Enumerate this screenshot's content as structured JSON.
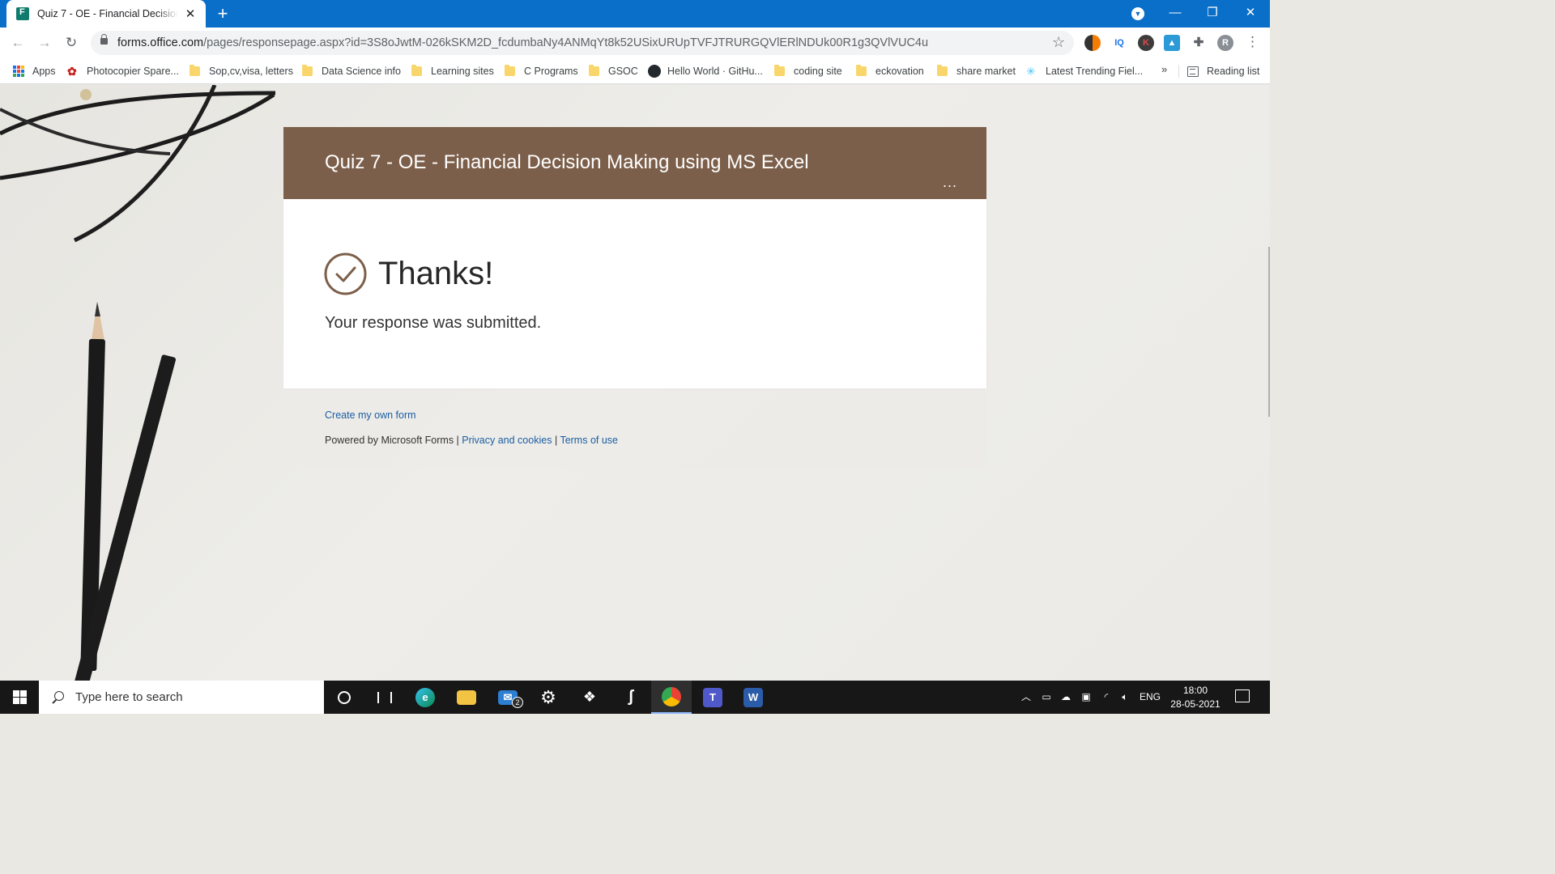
{
  "browser": {
    "tab_title": "Quiz 7 - OE - Financial Decision Making using MS Excel",
    "url_host": "forms.office.com",
    "url_path": "/pages/responsepage.aspx?id=3S8oJwtM-026kSKM2D_fcdumbaNy4ANMqYt8k52USixURUpTVFJTRURGQVlERlNDUk00R1g3QVlVUC4u",
    "back_icon": "arrow-left-icon",
    "forward_icon": "arrow-right-icon",
    "reload_icon": "reload-icon",
    "extensions": [
      "brand-extension",
      "IQ",
      "K",
      "drive-extension",
      "puzzle-icon"
    ],
    "profile_initial": "R",
    "accent": "#0a6fc9"
  },
  "bookmarks": {
    "items": [
      {
        "label": "Apps",
        "icon": "apps-icon"
      },
      {
        "label": "Photocopier Spare...",
        "icon": "photocopier-icon"
      },
      {
        "label": "Sop,cv,visa, letters",
        "icon": "folder-icon"
      },
      {
        "label": "Data Science info",
        "icon": "folder-icon"
      },
      {
        "label": "Learning sites",
        "icon": "folder-icon"
      },
      {
        "label": "C Programs",
        "icon": "folder-icon"
      },
      {
        "label": "GSOC",
        "icon": "folder-icon"
      },
      {
        "label": "Hello World · GitHu...",
        "icon": "github-icon"
      },
      {
        "label": "coding site",
        "icon": "folder-icon"
      },
      {
        "label": "eckovation",
        "icon": "folder-icon"
      },
      {
        "label": "share market",
        "icon": "folder-icon"
      },
      {
        "label": "Latest Trending Fiel...",
        "icon": "sparkle-icon"
      }
    ],
    "more": "»",
    "reading_list": "Reading list"
  },
  "form": {
    "title": "Quiz 7 - OE - Financial Decision Making using MS Excel",
    "more": "...",
    "thanks": "Thanks!",
    "submitted": "Your response was submitted.",
    "create_link": "Create my own form",
    "powered_by": "Powered by Microsoft Forms |",
    "privacy": "Privacy and cookies",
    "sep": "|",
    "terms": "Terms of use",
    "theme_color": "#7c5f4a"
  },
  "taskbar": {
    "search_placeholder": "Type here to search",
    "apps": [
      "cortana-icon",
      "task-view-icon",
      "edge-icon",
      "file-explorer-icon",
      "mail-icon",
      "settings-icon",
      "dropbox-icon",
      "app-icon",
      "chrome-icon",
      "teams-icon",
      "word-icon"
    ],
    "mail_badge": "2",
    "language": "ENG",
    "time": "18:00",
    "date": "28-05-2021"
  }
}
